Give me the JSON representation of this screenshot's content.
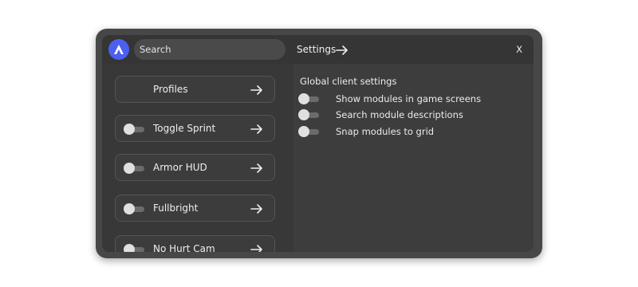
{
  "search": {
    "placeholder": "Search"
  },
  "modules": [
    {
      "label": "Profiles",
      "has_toggle": false,
      "enabled": false
    },
    {
      "label": "Toggle Sprint",
      "has_toggle": true,
      "enabled": false
    },
    {
      "label": "Armor HUD",
      "has_toggle": true,
      "enabled": false
    },
    {
      "label": "Fullbright",
      "has_toggle": true,
      "enabled": false
    },
    {
      "label": "No Hurt Cam",
      "has_toggle": true,
      "enabled": false
    }
  ],
  "settings_panel": {
    "title": "Settings",
    "close_label": "X",
    "section_title": "Global client settings",
    "options": [
      {
        "label": "Show modules in game screens",
        "enabled": false
      },
      {
        "label": "Search module descriptions",
        "enabled": false
      },
      {
        "label": "Snap modules to grid",
        "enabled": false
      }
    ]
  },
  "colors": {
    "accent": "#4b5ff0",
    "window_bg": "#474747",
    "panel_bg": "#383838"
  }
}
